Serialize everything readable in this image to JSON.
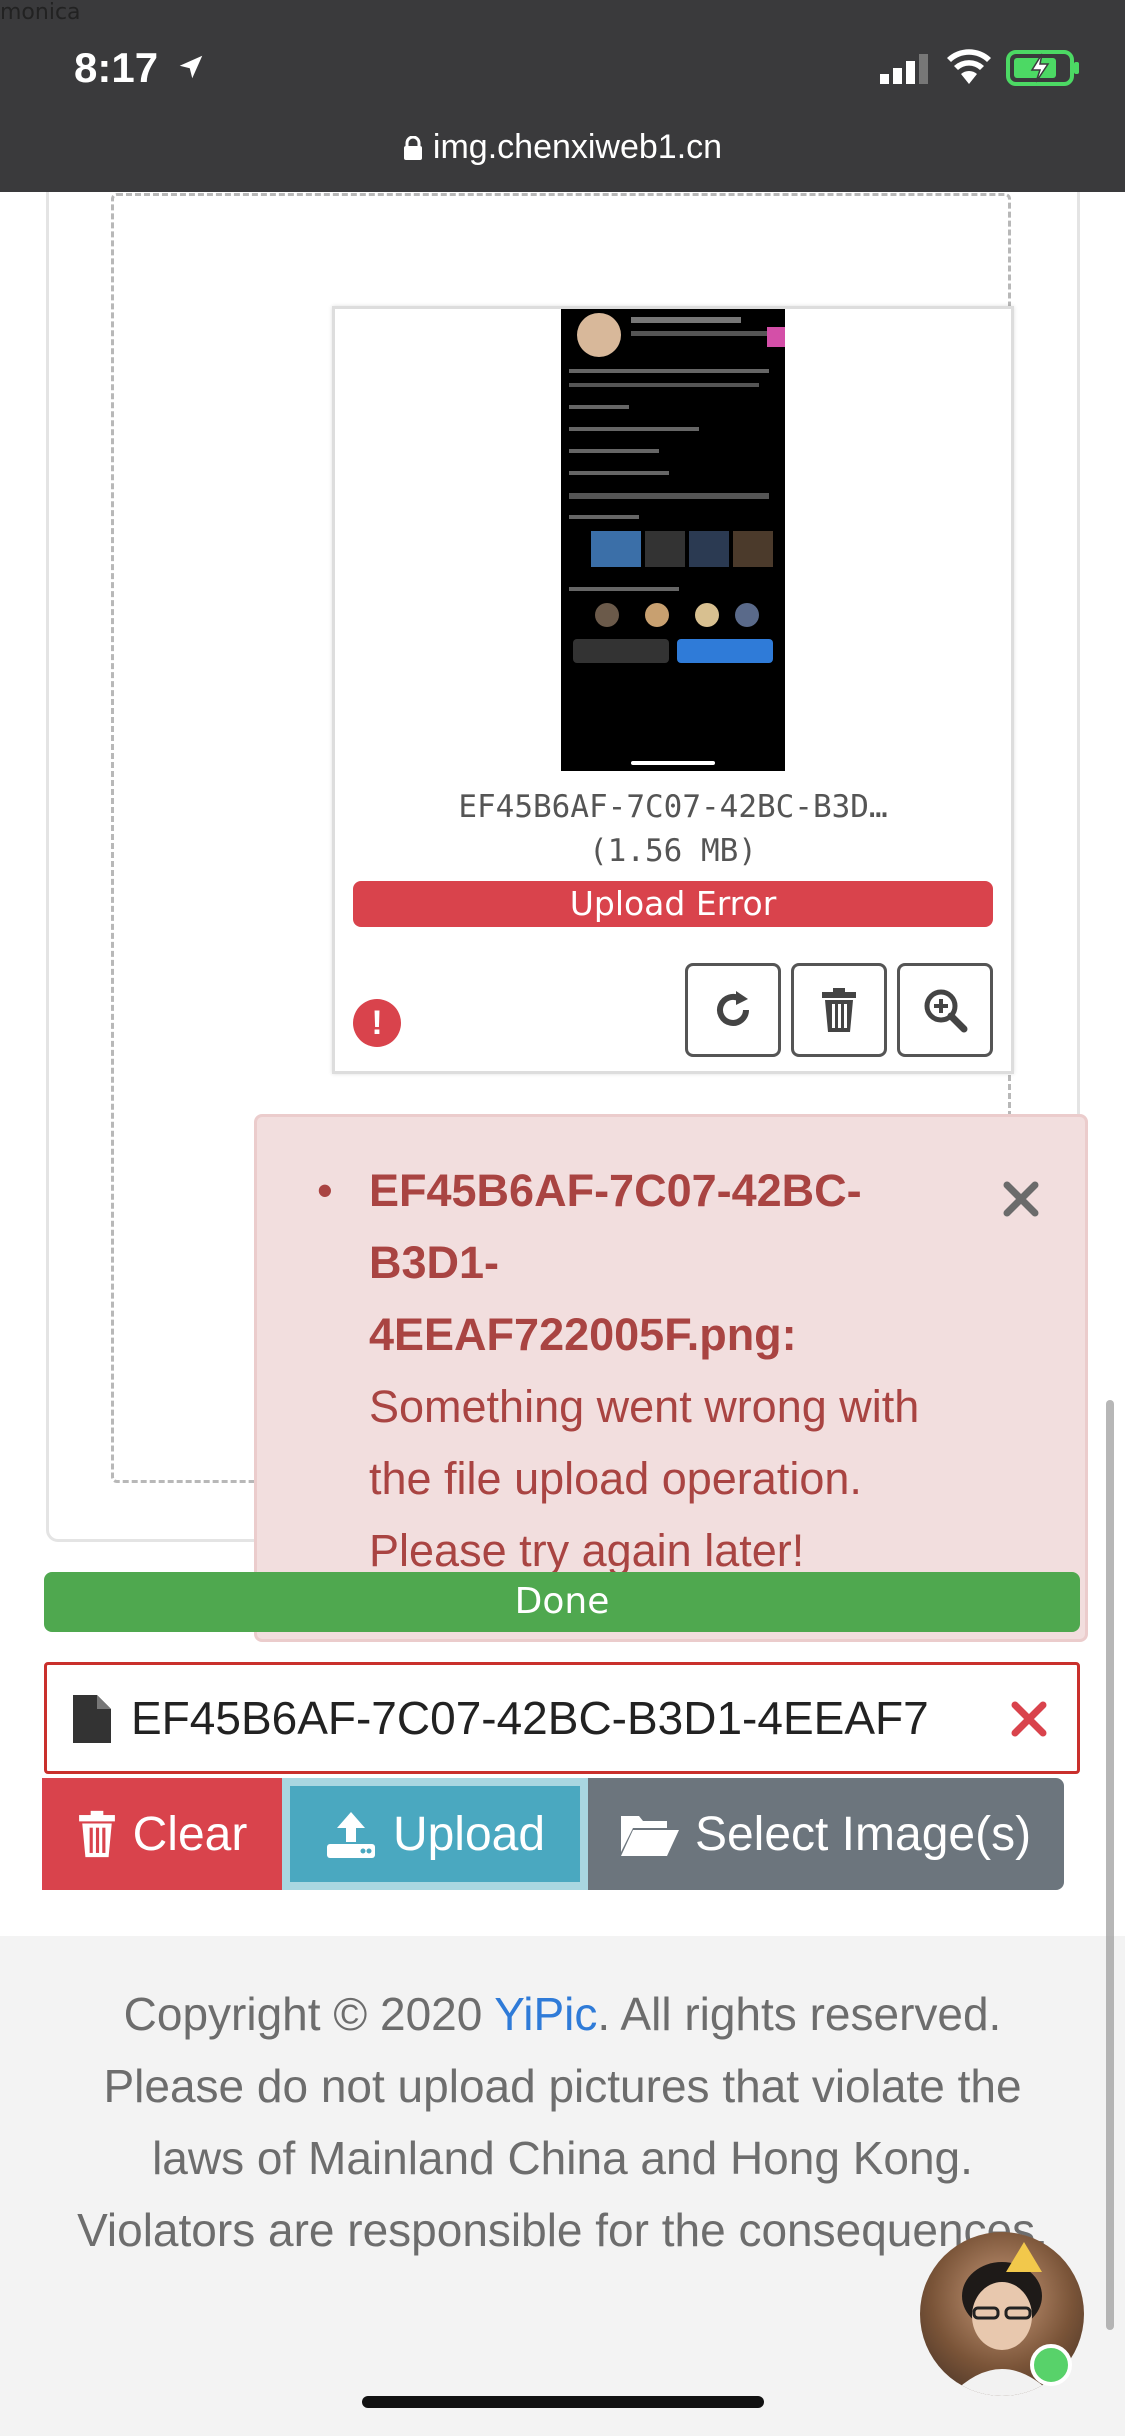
{
  "watermark": "monica",
  "status_bar": {
    "time": "8:17",
    "url": "img.chenxiweb1.cn"
  },
  "uploader": {
    "file_name_line1": "EF45B6AF-7C07-42BC-B3D…",
    "file_size": "(1.56 MB)",
    "upload_status": "Upload Error",
    "error_indicator": "!",
    "alert": {
      "file_line1": "EF45B6AF-7C07-42BC-",
      "file_line2": "B3D1-",
      "file_line3": "4EEAF722005F.png:",
      "message": "Something went wrong with the file upload operation. Please try again later!"
    },
    "progress_label": "Done",
    "selected_file": "EF45B6AF-7C07-42BC-B3D1-4EEAF7",
    "buttons": {
      "clear": "Clear",
      "upload": "Upload",
      "select": "Select Image(s)"
    }
  },
  "footer": {
    "text_before_link": "Copyright © 2020 ",
    "link": "YiPic",
    "text_after_link": ". All rights reserved. Please do not upload pictures that violate the laws of Mainland China and Hong Kong. Violators are responsible for the consequences."
  },
  "colors": {
    "danger": "#d9434c",
    "success": "#4fa84f",
    "info": "#4aa8c0",
    "secondary": "#6c757d",
    "alert_bg": "#f2dede",
    "alert_text": "#a94442",
    "link": "#2f7bd8"
  },
  "icons": [
    "location-arrow-icon",
    "signal-icon",
    "wifi-icon",
    "battery-charging-icon",
    "lock-icon",
    "retry-icon",
    "trash-icon",
    "zoom-in-icon",
    "close-icon",
    "file-icon",
    "remove-icon",
    "upload-icon",
    "folder-open-icon"
  ]
}
